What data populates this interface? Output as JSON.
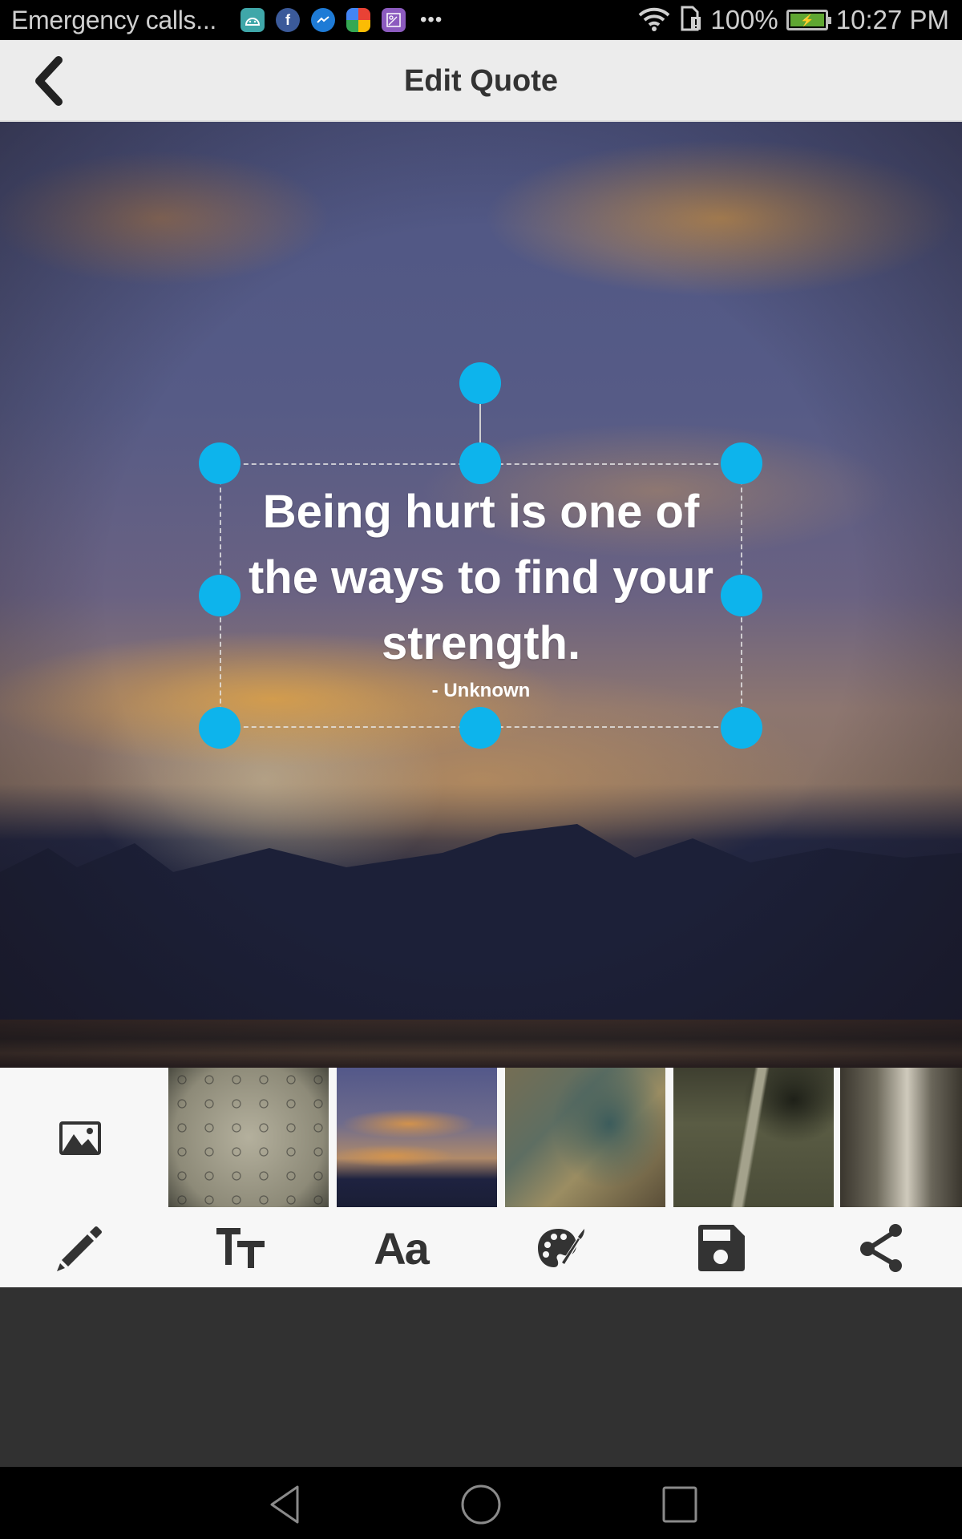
{
  "status_bar": {
    "carrier_text": "Emergency calls...",
    "notification_icons": [
      "android-icon",
      "facebook-icon",
      "messenger-icon",
      "play-games-icon",
      "gallery-icon"
    ],
    "more_indicator": "•••",
    "battery_percent": "100%",
    "battery_charging": true,
    "time": "10:27 PM",
    "colors": {
      "battery_fill": "#5fa632"
    }
  },
  "app_bar": {
    "title": "Edit Quote",
    "back_icon": "chevron-left-icon"
  },
  "canvas": {
    "background": "sunset-clouds",
    "quote": {
      "lines": [
        "Being hurt is one of",
        "the ways to find your",
        "strength."
      ],
      "author": "- Unknown",
      "text_color": "#ffffff",
      "selected": true,
      "handle_color": "#0db4ec"
    }
  },
  "background_picker": {
    "gallery_button_icon": "image-icon",
    "thumbnails": [
      {
        "name": "raindrops",
        "selected": false
      },
      {
        "name": "sunset-clouds",
        "selected": true
      },
      {
        "name": "sun-rays-clouds",
        "selected": false
      },
      {
        "name": "winding-road",
        "selected": false
      },
      {
        "name": "forest-path",
        "selected": false
      }
    ]
  },
  "toolbar": {
    "tools": [
      {
        "name": "edit",
        "icon": "pencil-icon"
      },
      {
        "name": "text-size",
        "icon": "text-size-icon",
        "glyph": "TT"
      },
      {
        "name": "font",
        "icon": "font-icon",
        "glyph": "Aa"
      },
      {
        "name": "color",
        "icon": "palette-icon"
      },
      {
        "name": "save",
        "icon": "save-icon"
      },
      {
        "name": "share",
        "icon": "share-icon"
      }
    ]
  },
  "nav_bar": {
    "buttons": [
      "back",
      "home",
      "recents"
    ]
  }
}
